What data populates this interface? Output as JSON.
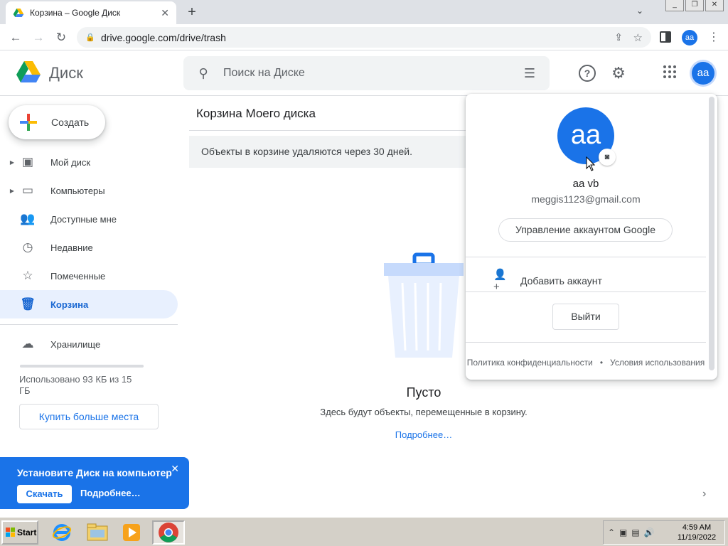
{
  "browser": {
    "tab_title": "Корзина – Google Диск",
    "url": "drive.google.com/drive/trash",
    "profile_initials": "aa"
  },
  "drive": {
    "logo_text": "Диск",
    "search_placeholder": "Поиск на Диске",
    "avatar_initials": "aa"
  },
  "sidebar": {
    "create_label": "Создать",
    "items": [
      {
        "label": "Мой диск",
        "icon": "my-drive-icon",
        "expandable": true
      },
      {
        "label": "Компьютеры",
        "icon": "computers-icon",
        "expandable": true
      },
      {
        "label": "Доступные мне",
        "icon": "shared-icon",
        "expandable": false
      },
      {
        "label": "Недавние",
        "icon": "clock-icon",
        "expandable": false
      },
      {
        "label": "Помеченные",
        "icon": "star-icon",
        "expandable": false
      },
      {
        "label": "Корзина",
        "icon": "trash-icon",
        "expandable": false,
        "active": true
      }
    ],
    "storage_label": "Хранилище",
    "storage_used_text": "Использовано 93 КБ из 15 ГБ",
    "storage_used_fraction": 1e-05,
    "buy_storage_label": "Купить больше места"
  },
  "promo": {
    "title": "Установите Диск на компьютер",
    "download_label": "Скачать",
    "more_label": "Подробнее…"
  },
  "main": {
    "title": "Корзина Моего диска",
    "notice": "Объекты в корзине удаляются через 30 дней.",
    "empty_title": "Пусто",
    "empty_description": "Здесь будут объекты, перемещенные в корзину.",
    "empty_link": "Подробнее…"
  },
  "account_popup": {
    "initials": "aa",
    "name": "aa vb",
    "email": "meggis1123@gmail.com",
    "manage_label": "Управление аккаунтом Google",
    "add_account_label": "Добавить аккаунт",
    "logout_label": "Выйти",
    "privacy_label": "Политика конфиденциальности",
    "separator": "•",
    "terms_label": "Условия использования"
  },
  "taskbar": {
    "start_label": "Start",
    "time": "4:59 AM",
    "date": "11/19/2022"
  },
  "colors": {
    "accent": "#1a73e8",
    "active_nav_bg": "#e8f0fe",
    "taskbar": "#d4d0c8"
  }
}
